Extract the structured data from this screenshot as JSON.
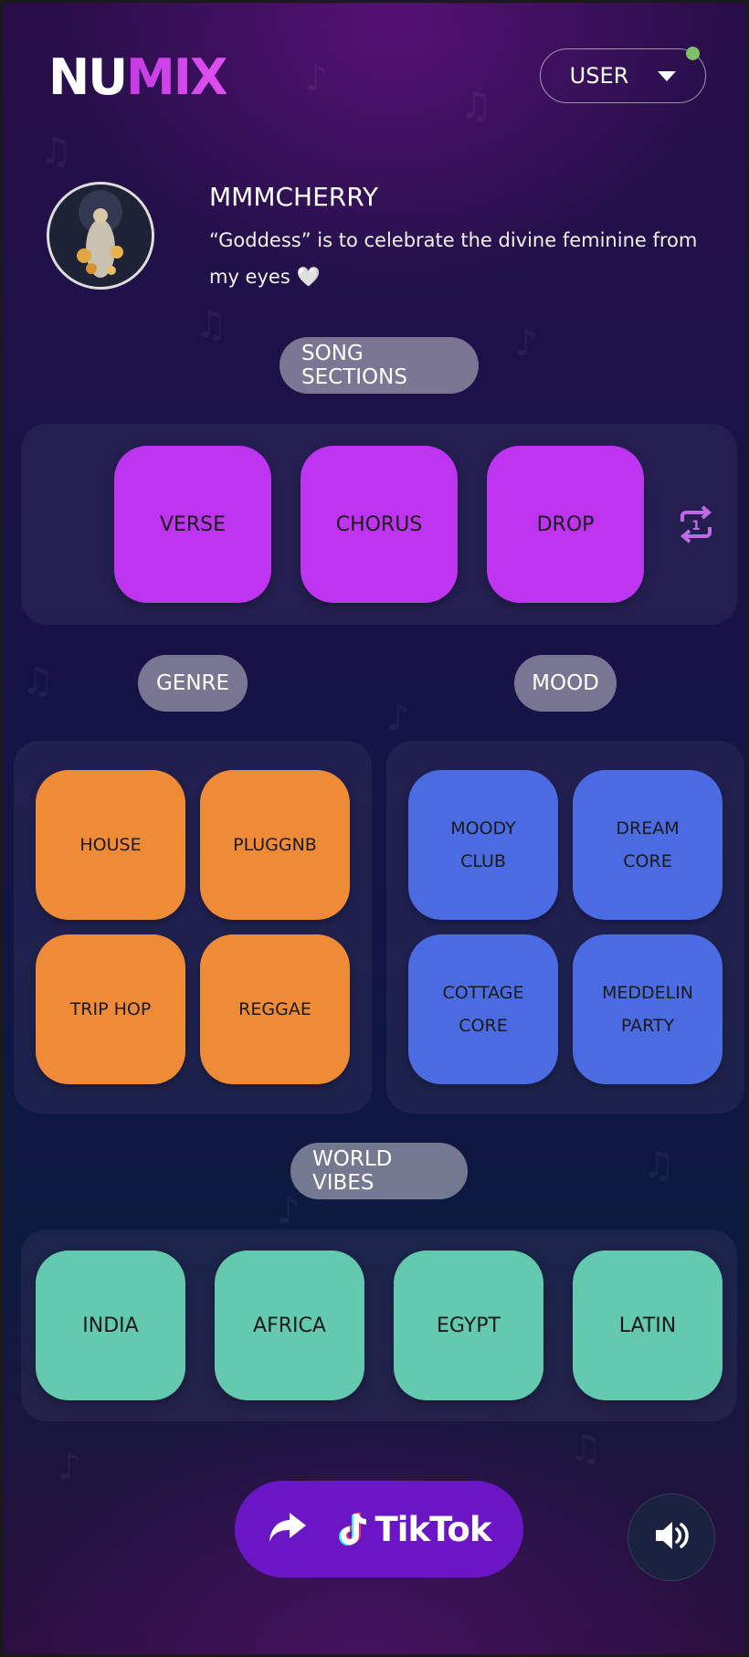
{
  "header": {
    "logo_part1": "NU",
    "logo_part2": "MIX",
    "user_label": "USER",
    "status_color": "#7fbf6a"
  },
  "profile": {
    "artist": "MMMCHERRY",
    "description": "“Goddess” is to celebrate the divine feminine from my eyes 🤍"
  },
  "song_sections": {
    "title": "SONG SECTIONS",
    "items": [
      "VERSE",
      "CHORUS",
      "DROP"
    ],
    "repeat_icon": "repeat-one-icon"
  },
  "genre": {
    "title": "GENRE",
    "items": [
      "HOUSE",
      "PLUGGNB",
      "TRIP HOP",
      "REGGAE"
    ]
  },
  "mood": {
    "title": "MOOD",
    "items": [
      {
        "line1": "MOODY",
        "line2": "CLUB"
      },
      {
        "line1": "DREAM",
        "line2": "CORE"
      },
      {
        "line1": "COTTAGE",
        "line2": "CORE"
      },
      {
        "line1": "MEDDELIN",
        "line2": "PARTY"
      }
    ]
  },
  "world_vibes": {
    "title": "WORLD VIBES",
    "items": [
      "INDIA",
      "AFRICA",
      "EGYPT",
      "LATIN"
    ]
  },
  "footer": {
    "share_label": "TikTok",
    "share_icon": "share-arrow-icon",
    "sound_icon": "speaker-icon"
  },
  "colors": {
    "sections": "#be34f0",
    "genre": "#ef8a37",
    "mood": "#4a6be2",
    "world": "#63cab0",
    "tiktok_button": "#6b16c4"
  }
}
